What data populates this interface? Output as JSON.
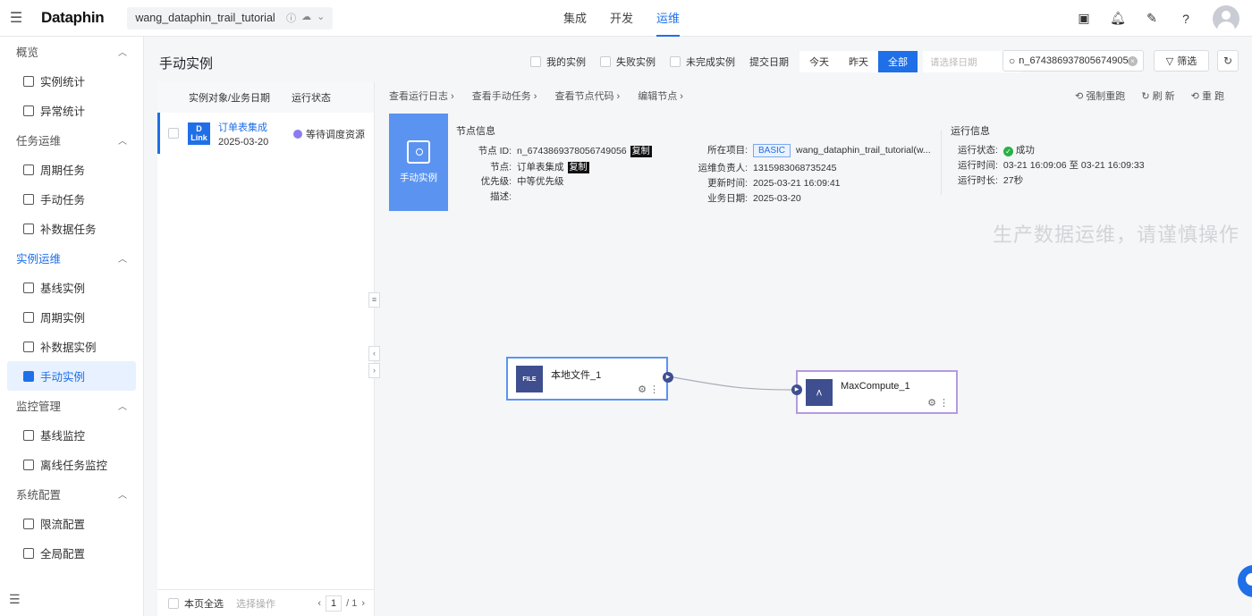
{
  "app": {
    "logo": "Dataphin",
    "project": "wang_dataphin_trail_tutorial"
  },
  "nav": [
    "集成",
    "开发",
    "运维"
  ],
  "nav_active": "运维",
  "sidebar": {
    "g1": "概览",
    "i_stat": "实例统计",
    "i_abn": "异常统计",
    "g2": "任务运维",
    "i_cycle_task": "周期任务",
    "i_manual_task": "手动任务",
    "i_patch_task": "补数据任务",
    "g3": "实例运维",
    "i_base_inst": "基线实例",
    "i_cycle_inst": "周期实例",
    "i_patch_inst": "补数据实例",
    "i_manual_inst": "手动实例",
    "g4": "监控管理",
    "i_base_mon": "基线监控",
    "i_offline_mon": "离线任务监控",
    "g5": "系统配置",
    "i_rate": "限流配置",
    "i_global": "全局配置"
  },
  "page_title": "手动实例",
  "filters": {
    "mine": "我的实例",
    "failed": "失败实例",
    "unfinished": "未完成实例",
    "submit_date": "提交日期",
    "today": "今天",
    "yesterday": "昨天",
    "all": "全部",
    "date_placeholder": "请选择日期",
    "search_value": "n_674386937805674905€",
    "filter_btn": "筛选"
  },
  "list": {
    "col1": "实例对象/业务日期",
    "col2": "运行状态",
    "rows": [
      {
        "name": "订单表集成",
        "date": "2025-03-20",
        "status": "等待调度资源"
      }
    ],
    "select_all": "本页全选",
    "bulk": "选择操作",
    "page": "1",
    "total": "/ 1"
  },
  "detail": {
    "tabs": [
      "查看运行日志 ›",
      "查看手动任务 ›",
      "查看节点代码 ›",
      "编辑节点 ›"
    ],
    "actions": [
      "强制重跑",
      "刷 新",
      "重 跑"
    ],
    "badge": "手动实例",
    "node_info_title": "节点信息",
    "node_id_k": "节点 ID:",
    "node_id_v": "n_6743869378056749056",
    "copy": "复制",
    "node_k": "节点:",
    "node_v": "订单表集成",
    "priority_k": "优先级:",
    "priority_v": "中等优先级",
    "desc_k": "描述:",
    "project_k": "所在项目:",
    "project_tag": "BASIC",
    "project_v": "wang_dataphin_trail_tutorial(w...",
    "owner_k": "运维负责人:",
    "owner_v": "1315983068735245",
    "updated_k": "更新时间:",
    "updated_v": "2025-03-21 16:09:41",
    "bizdate_k": "业务日期:",
    "bizdate_v": "2025-03-20",
    "run_info_title": "运行信息",
    "run_status_k": "运行状态:",
    "run_status_v": "成功",
    "run_time_k": "运行时间:",
    "run_time_v": "03-21 16:09:06 至 03-21 16:09:33",
    "run_dur_k": "运行时长:",
    "run_dur_v": "27秒"
  },
  "warning": "生产数据运维，请谨慎操作",
  "dag": {
    "node1": "本地文件_1",
    "node2": "MaxCompute_1",
    "file_label": "FILE"
  }
}
